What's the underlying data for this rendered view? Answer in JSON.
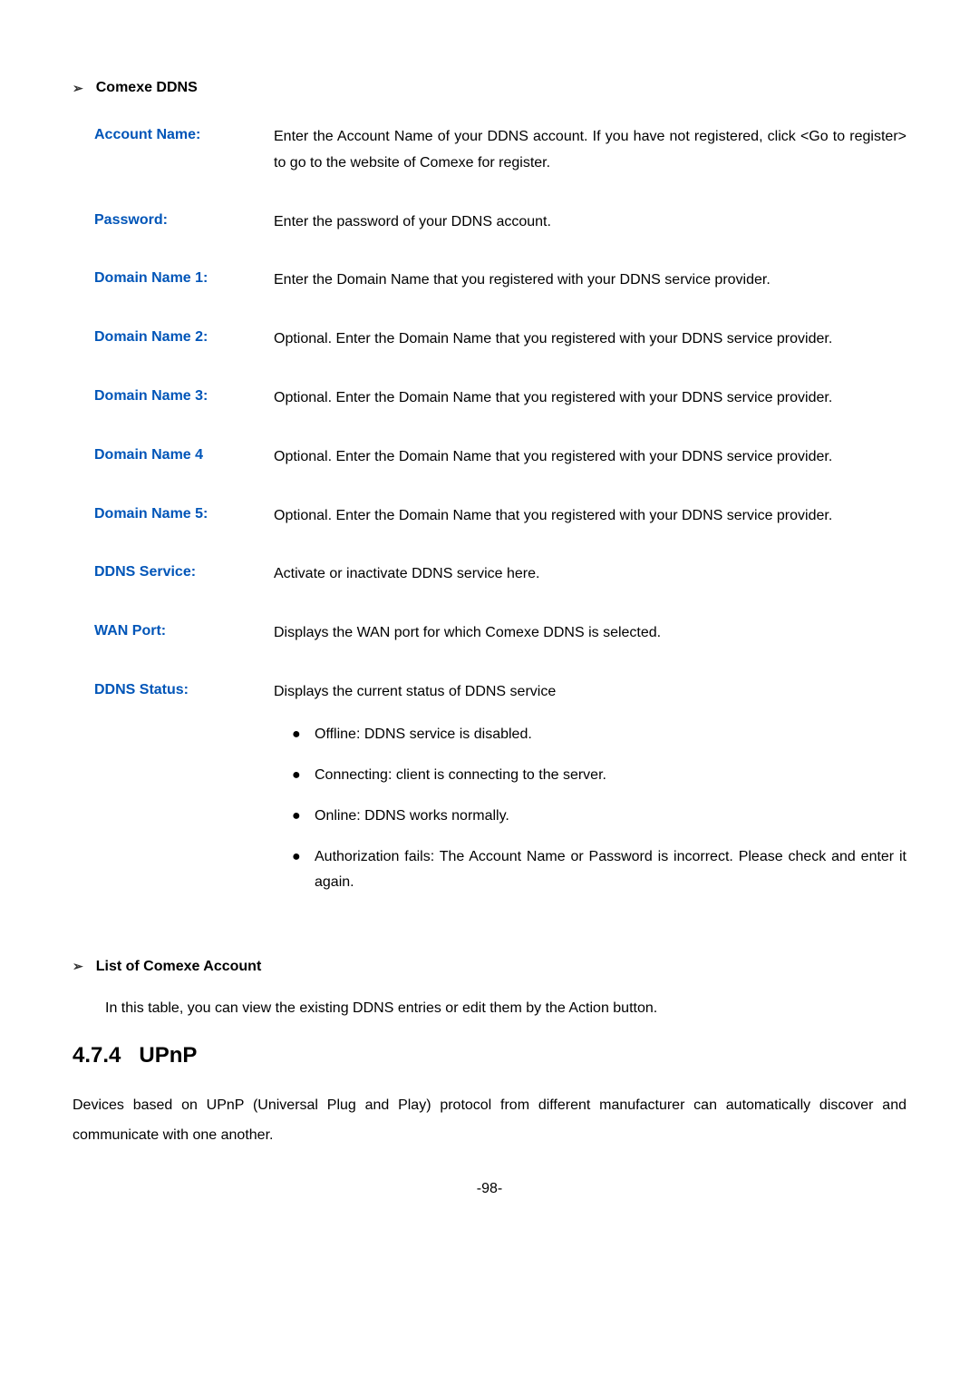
{
  "headings": {
    "comexe_ddns": "Comexe DDNS",
    "list_of_account": "List of Comexe Account",
    "upnp_section": "4.7.4   UPnP"
  },
  "fields": {
    "account_name": {
      "label": "Account Name:",
      "value": "Enter the Account Name of your DDNS account. If you have not registered, click <Go to register> to go to the website of Comexe for register."
    },
    "password": {
      "label": "Password:",
      "value": "Enter the password of your DDNS account."
    },
    "domain_name_1": {
      "label": "Domain Name 1:",
      "value": "Enter the Domain Name that you registered with your DDNS service provider."
    },
    "domain_name_2": {
      "label": "Domain Name 2:",
      "value": "Optional. Enter the Domain Name that you registered with your DDNS service provider."
    },
    "domain_name_3": {
      "label": "Domain Name 3:",
      "value": "Optional. Enter the Domain Name that you registered with your DDNS service provider."
    },
    "domain_name_4": {
      "label": "Domain Name 4",
      "value": "Optional. Enter the Domain Name that you registered with your DDNS service provider."
    },
    "domain_name_5": {
      "label": "Domain Name 5:",
      "value": "Optional. Enter the Domain Name that you registered with your DDNS service provider."
    },
    "ddns_service": {
      "label": "DDNS Service:",
      "value": "Activate or inactivate DDNS service here."
    },
    "wan_port": {
      "label": "WAN Port:",
      "value": "Displays the WAN port for which Comexe DDNS is selected."
    },
    "ddns_status": {
      "label": "DDNS Status:",
      "value": "Displays the current status of DDNS service"
    }
  },
  "status_items": {
    "offline": "Offline: DDNS service is disabled.",
    "connecting": "Connecting: client is connecting to the server.",
    "online": "Online: DDNS works normally.",
    "auth_fails": "Authorization fails: The Account Name or Password is incorrect. Please check and enter it again."
  },
  "list_account_text": "In this table, you can view the existing DDNS entries or edit them by the Action button.",
  "upnp_text": "Devices based on UPnP (Universal Plug and Play) protocol from different manufacturer can automatically discover and communicate with one another.",
  "page_number": "-98-"
}
